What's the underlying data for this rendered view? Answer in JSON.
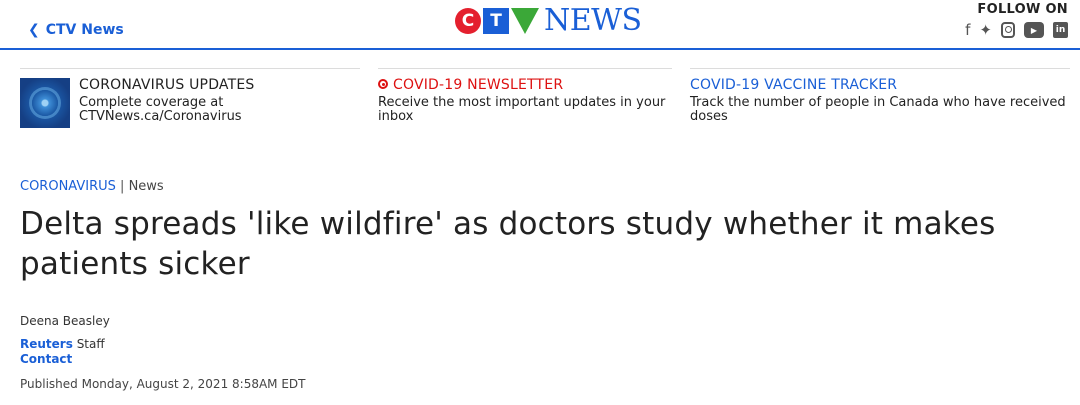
{
  "header": {
    "back_label": "CTV News",
    "logo_letters": [
      "C",
      "T",
      "V"
    ],
    "logo_word": "NEWS",
    "follow_label": "FOLLOW ON",
    "social_icons": [
      "facebook-icon",
      "twitter-icon",
      "instagram-icon",
      "youtube-icon",
      "linkedin-icon"
    ]
  },
  "promos": [
    {
      "title": "CORONAVIRUS UPDATES",
      "description": "Complete coverage at CTVNews.ca/Coronavirus"
    },
    {
      "title": "COVID-19 NEWSLETTER",
      "description": "Receive the most important updates in your inbox"
    },
    {
      "title": "COVID-19 VACCINE TRACKER",
      "description": "Track the number of people in Canada who have received doses"
    }
  ],
  "article": {
    "category": "CORONAVIRUS",
    "separator": "|",
    "section": "News",
    "headline": "Delta spreads 'like wildfire' as doctors study whether it makes patients sicker",
    "author": "Deena Beasley",
    "org_link": "Reuters",
    "org_role": "Staff",
    "contact_label": "Contact",
    "published": "Published Monday, August 2, 2021 8:58AM EDT"
  },
  "colors": {
    "brand_blue": "#1a5fd6",
    "brand_red": "#e4202e",
    "brand_green": "#3ba838",
    "newsletter_red": "#dd1111"
  }
}
